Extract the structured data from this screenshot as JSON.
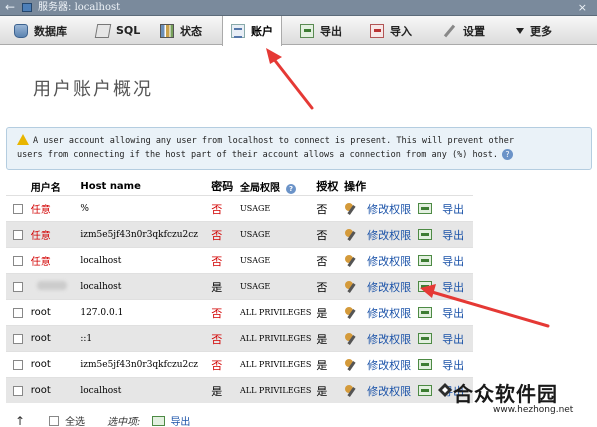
{
  "window": {
    "back_glyph": "←",
    "title_prefix": "服务器: ",
    "title_host": "localhost",
    "close_glyph": "×"
  },
  "tabs": [
    {
      "label": "数据库",
      "icon": "database-icon"
    },
    {
      "label": "SQL",
      "icon": "sql-icon"
    },
    {
      "label": "状态",
      "icon": "status-icon"
    },
    {
      "label": "账户",
      "icon": "accounts-icon",
      "active": true
    },
    {
      "label": "导出",
      "icon": "export-icon"
    },
    {
      "label": "导入",
      "icon": "import-icon"
    },
    {
      "label": "设置",
      "icon": "settings-icon"
    },
    {
      "label": "更多",
      "icon": "chevron-down-icon"
    }
  ],
  "page_title": "用户账户概况",
  "notice": {
    "line1": "A user account allowing any user from localhost to connect is present. This will prevent other",
    "line2": "users from connecting if the host part of their account allows a connection from any (%) host.",
    "help_glyph": "?"
  },
  "table": {
    "headers": {
      "user": "用户名",
      "host": "Host name",
      "password": "密码",
      "global_priv": "全局权限",
      "grant": "授权",
      "action": "操作"
    },
    "help_glyph": "?",
    "edit_label": "修改权限",
    "export_label": "导出",
    "rows": [
      {
        "user": "任意",
        "host": "%",
        "password": "否",
        "priv": "USAGE",
        "grant": "否"
      },
      {
        "user": "任意",
        "host": "izm5e5jf43n0r3qkfczu2cz",
        "password": "否",
        "priv": "USAGE",
        "grant": "否"
      },
      {
        "user": "任意",
        "host": "localhost",
        "password": "否",
        "priv": "USAGE",
        "grant": "否"
      },
      {
        "user": "",
        "host": "localhost",
        "password": "是",
        "priv": "USAGE",
        "grant": "否"
      },
      {
        "user": "root",
        "host": "127.0.0.1",
        "password": "否",
        "priv": "ALL PRIVILEGES",
        "grant": "是"
      },
      {
        "user": "root",
        "host": "::1",
        "password": "否",
        "priv": "ALL PRIVILEGES",
        "grant": "是"
      },
      {
        "user": "root",
        "host": "izm5e5jf43n0r3qkfczu2cz",
        "password": "否",
        "priv": "ALL PRIVILEGES",
        "grant": "是"
      },
      {
        "user": "root",
        "host": "localhost",
        "password": "是",
        "priv": "ALL PRIVILEGES",
        "grant": "是"
      }
    ]
  },
  "footer": {
    "up_glyph": "↑",
    "select_all": "全选",
    "with_selected": "选中项:",
    "export": "导出"
  },
  "watermark": {
    "title": "合众软件园",
    "url": "www.hezhong.net"
  },
  "colors": {
    "red_text": "#d20000",
    "link": "#1a52a8",
    "arrow": "#e53935"
  }
}
